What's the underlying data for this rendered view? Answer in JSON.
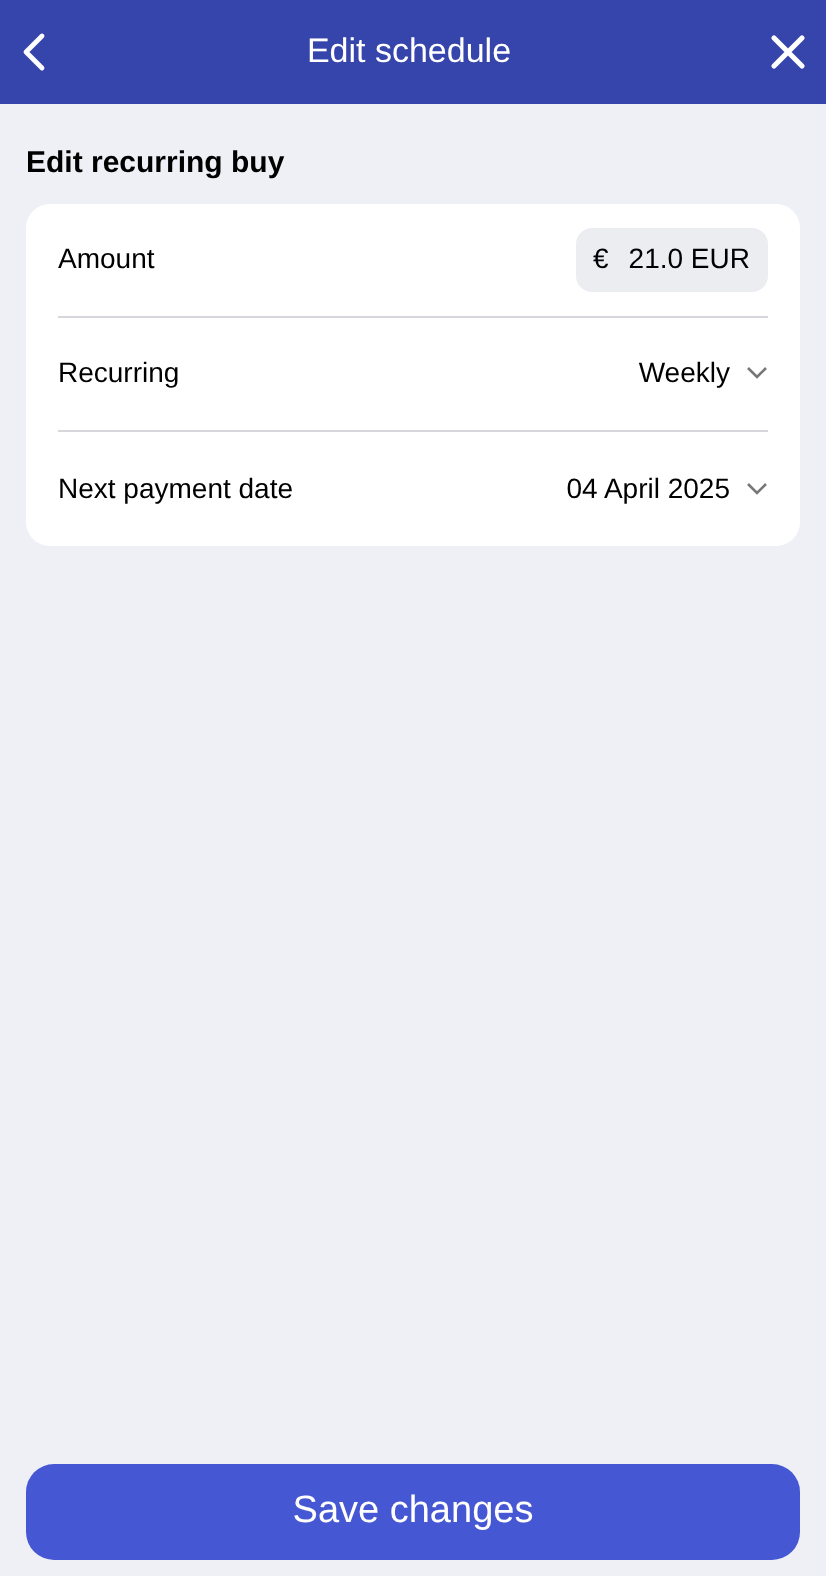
{
  "header": {
    "title": "Edit schedule"
  },
  "section_title": "Edit recurring buy",
  "rows": [
    {
      "kind": "amount",
      "label": "Amount",
      "currency_symbol": "€",
      "value": "21.0 EUR"
    },
    {
      "kind": "dropdown",
      "label": "Recurring",
      "value": "Weekly"
    },
    {
      "kind": "dropdown",
      "label": "Next payment date",
      "value": "04 April 2025"
    }
  ],
  "save_button": "Save changes"
}
